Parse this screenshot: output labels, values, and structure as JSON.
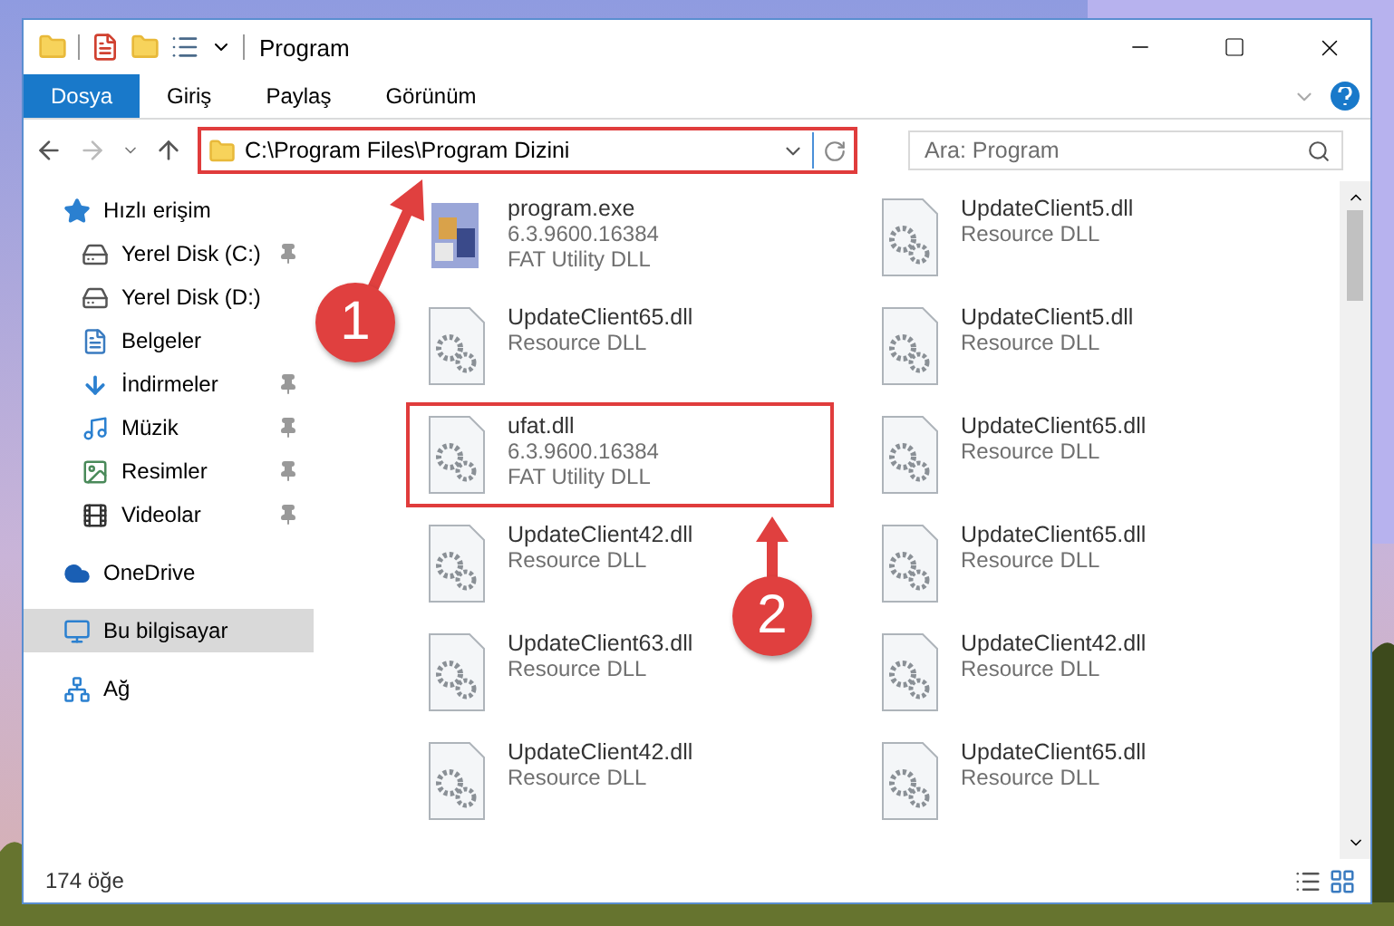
{
  "window": {
    "title": "Program"
  },
  "ribbon_tabs": [
    {
      "label": "Dosya",
      "selected": true
    },
    {
      "label": "Giriş",
      "selected": false
    },
    {
      "label": "Paylaş",
      "selected": false
    },
    {
      "label": "Görünüm",
      "selected": false
    }
  ],
  "address": {
    "value": "C:\\Program Files\\Program Dizini",
    "highlighted": true
  },
  "search": {
    "placeholder": "Ara: Program"
  },
  "sidebar": {
    "items": [
      {
        "label": "Hızlı erişim",
        "selected": false,
        "children": [
          {
            "label": "Yerel Disk (C:)",
            "pinned": true,
            "selected": false
          },
          {
            "label": "Yerel Disk (D:)",
            "pinned": false,
            "selected": false
          },
          {
            "label": "Belgeler",
            "pinned": false,
            "selected": false
          },
          {
            "label": "İndirmeler",
            "pinned": true,
            "selected": false
          },
          {
            "label": "Müzik",
            "pinned": true,
            "selected": false
          },
          {
            "label": "Resimler",
            "pinned": true,
            "selected": false
          },
          {
            "label": "Videolar",
            "pinned": true,
            "selected": false
          }
        ]
      },
      {
        "label": "OneDrive",
        "selected": false
      },
      {
        "label": "Bu bilgisayar",
        "selected": true
      },
      {
        "label": "Ağ",
        "selected": false
      }
    ]
  },
  "files": [
    {
      "kind": "exe",
      "name": "program.exe",
      "lines": [
        "6.3.9600.16384",
        "FAT Utility DLL"
      ],
      "highlighted": false
    },
    {
      "kind": "dll",
      "name": "UpdateClient5.dll",
      "lines": [
        "Resource DLL"
      ],
      "highlighted": false
    },
    {
      "kind": "dll",
      "name": "UpdateClient65.dll",
      "lines": [
        "Resource DLL"
      ],
      "highlighted": false
    },
    {
      "kind": "dll",
      "name": "UpdateClient5.dll",
      "lines": [
        "Resource DLL"
      ],
      "highlighted": false
    },
    {
      "kind": "dll",
      "name": "ufat.dll",
      "lines": [
        "6.3.9600.16384",
        "FAT Utility DLL"
      ],
      "highlighted": true
    },
    {
      "kind": "dll",
      "name": "UpdateClient65.dll",
      "lines": [
        "Resource DLL"
      ],
      "highlighted": false
    },
    {
      "kind": "dll",
      "name": "UpdateClient42.dll",
      "lines": [
        "Resource DLL"
      ],
      "highlighted": false
    },
    {
      "kind": "dll",
      "name": "UpdateClient65.dll",
      "lines": [
        "Resource DLL"
      ],
      "highlighted": false
    },
    {
      "kind": "dll",
      "name": "UpdateClient63.dll",
      "lines": [
        "Resource DLL"
      ],
      "highlighted": false
    },
    {
      "kind": "dll",
      "name": "UpdateClient42.dll",
      "lines": [
        "Resource DLL"
      ],
      "highlighted": false
    },
    {
      "kind": "dll",
      "name": "UpdateClient42.dll",
      "lines": [
        "Resource DLL"
      ],
      "highlighted": false
    },
    {
      "kind": "dll",
      "name": "UpdateClient65.dll",
      "lines": [
        "Resource DLL"
      ],
      "highlighted": false
    }
  ],
  "status_bar": {
    "count": "174 öğe"
  },
  "callouts": [
    {
      "number": "1"
    },
    {
      "number": "2"
    }
  ]
}
